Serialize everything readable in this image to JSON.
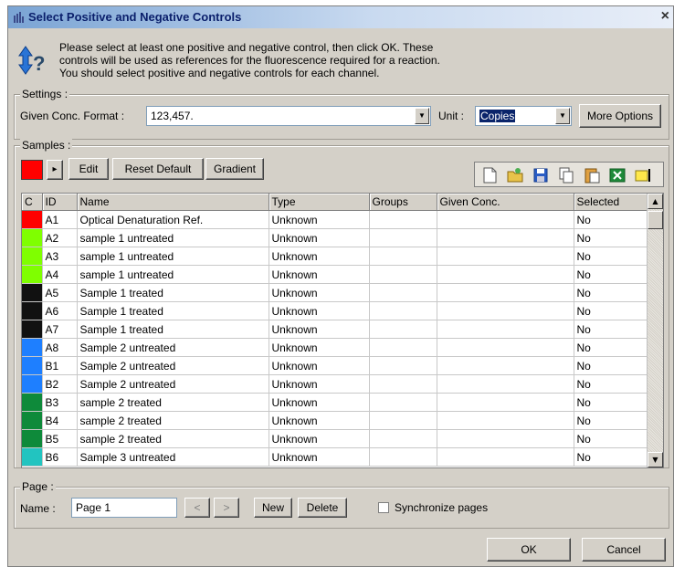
{
  "window": {
    "title": "Select Positive and Negative Controls",
    "close_glyph": "×"
  },
  "info": {
    "lines": [
      "Please select at least one positive and negative control, then click OK. These",
      "controls will be used as references for the fluorescence required for a reaction.",
      "You should select positive and negative controls for each channel."
    ],
    "icon": "question-arrows-icon"
  },
  "settings": {
    "label": "Settings :",
    "format_label": "Given Conc. Format :",
    "format_value": "123,457.",
    "unit_label": "Unit :",
    "unit_value": "Copies",
    "more_options": "More Options"
  },
  "samples": {
    "label": "Samples :",
    "current_color": "#ff0000",
    "arrow_glyph": "▸",
    "edit": "Edit",
    "reset_default": "Reset Default",
    "gradient": "Gradient",
    "toolbar_icons": [
      "new-page-icon",
      "open-folder-icon",
      "save-icon",
      "copy-icon",
      "paste-icon",
      "excel-export-icon",
      "highlight-icon"
    ],
    "columns": [
      "C",
      "ID",
      "Name",
      "Type",
      "Groups",
      "Given Conc.",
      "Selected"
    ],
    "rows": [
      {
        "color": "#ff0000",
        "id": "A1",
        "name": "Optical Denaturation Ref.",
        "type": "Unknown",
        "groups": "",
        "conc": "",
        "selected": "No"
      },
      {
        "color": "#7fff00",
        "id": "A2",
        "name": "sample 1 untreated",
        "type": "Unknown",
        "groups": "",
        "conc": "",
        "selected": "No"
      },
      {
        "color": "#7fff00",
        "id": "A3",
        "name": "sample 1 untreated",
        "type": "Unknown",
        "groups": "",
        "conc": "",
        "selected": "No"
      },
      {
        "color": "#7fff00",
        "id": "A4",
        "name": "sample 1 untreated",
        "type": "Unknown",
        "groups": "",
        "conc": "",
        "selected": "No"
      },
      {
        "color": "#111111",
        "id": "A5",
        "name": "Sample 1 treated",
        "type": "Unknown",
        "groups": "",
        "conc": "",
        "selected": "No"
      },
      {
        "color": "#111111",
        "id": "A6",
        "name": "Sample 1 treated",
        "type": "Unknown",
        "groups": "",
        "conc": "",
        "selected": "No"
      },
      {
        "color": "#111111",
        "id": "A7",
        "name": "Sample 1 treated",
        "type": "Unknown",
        "groups": "",
        "conc": "",
        "selected": "No"
      },
      {
        "color": "#1e7fff",
        "id": "A8",
        "name": "Sample 2 untreated",
        "type": "Unknown",
        "groups": "",
        "conc": "",
        "selected": "No"
      },
      {
        "color": "#1e7fff",
        "id": "B1",
        "name": "Sample 2 untreated",
        "type": "Unknown",
        "groups": "",
        "conc": "",
        "selected": "No"
      },
      {
        "color": "#1e7fff",
        "id": "B2",
        "name": "Sample 2 untreated",
        "type": "Unknown",
        "groups": "",
        "conc": "",
        "selected": "No"
      },
      {
        "color": "#0e8a3a",
        "id": "B3",
        "name": "sample 2 treated",
        "type": "Unknown",
        "groups": "",
        "conc": "",
        "selected": "No"
      },
      {
        "color": "#0e8a3a",
        "id": "B4",
        "name": "sample 2 treated",
        "type": "Unknown",
        "groups": "",
        "conc": "",
        "selected": "No"
      },
      {
        "color": "#0e8a3a",
        "id": "B5",
        "name": "sample 2 treated",
        "type": "Unknown",
        "groups": "",
        "conc": "",
        "selected": "No"
      },
      {
        "color": "#22c4c0",
        "id": "B6",
        "name": "Sample 3 untreated",
        "type": "Unknown",
        "groups": "",
        "conc": "",
        "selected": "No"
      }
    ]
  },
  "page": {
    "label": "Page :",
    "name_label": "Name :",
    "name_value": "Page 1",
    "prev": "<",
    "next": ">",
    "new": "New",
    "delete": "Delete",
    "sync_label": "Synchronize pages",
    "sync_checked": false
  },
  "footer": {
    "ok": "OK",
    "cancel": "Cancel"
  }
}
